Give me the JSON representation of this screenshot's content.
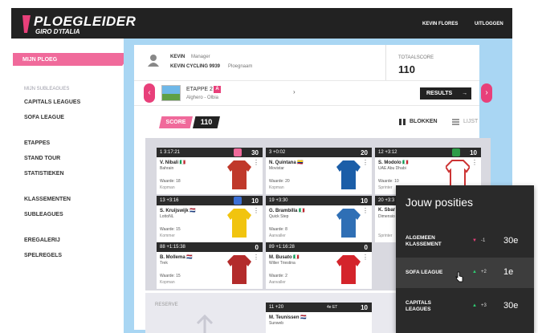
{
  "brand": {
    "title": "PLOEGLEIDER",
    "subtitle": "GIRO D'ITALIA"
  },
  "topbar": {
    "user": "KEVIN FLORES",
    "logout": "UITLOGGEN"
  },
  "sidebar": {
    "active": "MIJN PLOEG",
    "subleagues_header": "MIJN SUBLEAGUES",
    "items": [
      "CAPITALS LEAGUES",
      "SOFA LEAGUE",
      "ETAPPES",
      "STAND TOUR",
      "STATISTIEKEN",
      "KLASSEMENTEN",
      "SUBLEAGUES",
      "EREGALERIJ",
      "SPELREGELS"
    ]
  },
  "header": {
    "manager_name": "KEVIN",
    "manager_label": "Manager",
    "team_name": "KEVIN CYCLING 9939",
    "team_label": "Ploegnaam",
    "total_label": "TOTAALSCORE",
    "total_value": "110"
  },
  "stage": {
    "name": "ETAPPE 2",
    "badge": "A",
    "route": "Alghero - Olbia",
    "results_label": "RESULTS",
    "results_arrow": "→"
  },
  "score": {
    "label": "SCORE",
    "value": "110"
  },
  "views": {
    "blocks": "BLOKKEN",
    "list": "LIJST"
  },
  "cards": [
    {
      "h_left": "1   3:17:21",
      "points": "30",
      "jersey": "#f06a9b",
      "name": "V. Nibali 🇮🇹",
      "team": "Bahrain",
      "value": "Waarde: 18",
      "role": "Kopman",
      "shirt": "#c0392b"
    },
    {
      "h_left": "3   +0:02",
      "points": "20",
      "jersey": "",
      "name": "N. Quintana 🇨🇴",
      "team": "Movistar",
      "value": "Waarde: 20",
      "role": "Kopman",
      "shirt": "#1b5ea8"
    },
    {
      "h_left": "12   +3:12",
      "points": "10",
      "jersey": "#2e9c48",
      "name": "S. Modolo 🇮🇹",
      "team": "UAE Abu Dhabi",
      "value": "Waarde: 10",
      "role": "Sprinter",
      "shirt": "#ffffff"
    },
    {
      "h_left": "13   +3:16",
      "points": "10",
      "jersey": "#3b6fd6",
      "name": "S. Kruijswijk 🇳🇱",
      "team": "LottoNL",
      "value": "Waarde: 15",
      "role": "Kommer",
      "shirt": "#f1c40f"
    },
    {
      "h_left": "19   +3:30",
      "points": "10",
      "jersey": "",
      "name": "G. Brambilla 🇮🇹",
      "team": "Quick Step",
      "value": "Waarde: 8",
      "role": "Aanvaller",
      "shirt": "#2f6fb5"
    },
    {
      "h_left": "20   +3:3",
      "points": "",
      "jersey": "",
      "name": "K. Sbar",
      "team": "Dimensio",
      "value": "",
      "role": "Sprinter",
      "shirt": "#ffffff"
    },
    {
      "h_left": "88   +1:15:38",
      "points": "0",
      "jersey": "",
      "name": "B. Mollema 🇳🇱",
      "team": "Trek",
      "value": "Waarde: 15",
      "role": "Kopman",
      "shirt": "#b32b2b"
    },
    {
      "h_left": "89   +1:16:28",
      "points": "0",
      "jersey": "",
      "name": "M. Busato 🇮🇹",
      "team": "Wilier Triestina",
      "value": "Waarde: 2",
      "role": "Aanvaller",
      "shirt": "#d4242b"
    }
  ],
  "reserve": {
    "label": "RESERVE",
    "card": {
      "h_left": "11   +20",
      "h_mid": "4e ET",
      "points": "10",
      "name": "M. Teunissen 🇳🇱",
      "team": "Sunweb"
    }
  },
  "popup": {
    "title": "Jouw posities",
    "rows": [
      {
        "name": "ALGEMEEN KLASSEMENT",
        "dir": "▼",
        "dir_color": "#e8407a",
        "delta": "-1",
        "pos": "30e"
      },
      {
        "name": "SOFA LEAGUE",
        "dir": "▲",
        "dir_color": "#2ecc71",
        "delta": "+2",
        "pos": "1e"
      },
      {
        "name": "CAPITALS LEAGUES",
        "dir": "▲",
        "dir_color": "#2ecc71",
        "delta": "+3",
        "pos": "30e"
      }
    ]
  }
}
